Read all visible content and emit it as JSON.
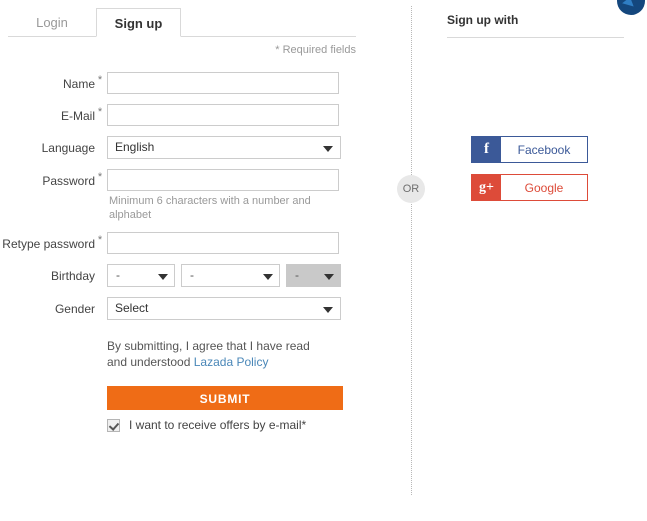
{
  "tabs": [
    {
      "label": "Login",
      "active": false
    },
    {
      "label": "Sign up",
      "active": true
    }
  ],
  "required_note": "* Required fields",
  "form": {
    "fields": [
      {
        "label": "Name",
        "required": true,
        "type": "text",
        "value": ""
      },
      {
        "label": "E-Mail",
        "required": true,
        "type": "text",
        "value": ""
      },
      {
        "label": "Language",
        "required": false,
        "type": "select",
        "value": "English"
      },
      {
        "label": "Password",
        "required": true,
        "type": "text",
        "value": ""
      },
      {
        "label": "Retype password",
        "required": true,
        "type": "text",
        "value": ""
      },
      {
        "label": "Birthday",
        "required": false,
        "type": "date-group",
        "value": "-"
      },
      {
        "label": "Gender",
        "required": false,
        "type": "select",
        "value": "Select"
      }
    ],
    "password_hint": "Minimum 6 characters with a number and alphabet",
    "birthday": {
      "day": "-",
      "month": "-",
      "year": "-"
    },
    "agreement": {
      "text": "By submitting, I agree that I have read and understood ",
      "link_text": "Lazada Policy"
    },
    "submit_label": "SUBMIT",
    "offers_label": "I want to receive offers by e-mail*",
    "offers_checked": true
  },
  "divider": {
    "or_label": "OR"
  },
  "social_panel": {
    "title": "Sign up with",
    "buttons": [
      {
        "name": "Facebook",
        "glyph": "f",
        "color": "#3b5998"
      },
      {
        "name": "Google",
        "glyph": "g+",
        "color": "#dd4b39"
      }
    ]
  },
  "colors": {
    "submit_orange": "#ef6c16",
    "link_blue": "#4a87b8",
    "facebook_blue": "#3b5998",
    "google_red": "#dd4b39",
    "widget_navy": "#14477d"
  }
}
